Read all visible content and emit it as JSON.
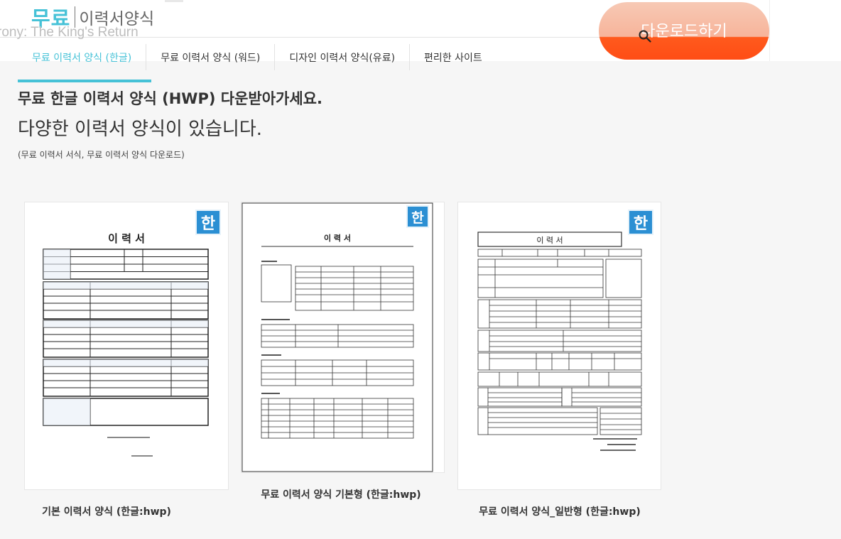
{
  "header": {
    "logo_main": "무료",
    "logo_sub": "이력서양식",
    "ghost_text": "rony: The King's Return",
    "download_label": "다운로드하기"
  },
  "nav": {
    "items": [
      {
        "label": "무료 이력서 양식 (한글)",
        "active": true
      },
      {
        "label": "무료 이력서 양식 (워드)",
        "active": false
      },
      {
        "label": "디자인 이력서 양식(유료)",
        "active": false
      },
      {
        "label": "편리한 사이트",
        "active": false
      }
    ]
  },
  "main": {
    "heading": "무료 한글 이력서 양식 (HWP) 다운받아가세요.",
    "subheading": "다양한 이력서 양식이 있습니다.",
    "note": "(무료 이력서 서식, 무료 이력서 양식 다운로드)"
  },
  "cards": [
    {
      "caption": "기본 이력서 양식 (한글:hwp)",
      "doc_title": "이 력 서",
      "icon": "hwp-icon"
    },
    {
      "caption": "무료 이력서 양식 기본형 (한글:hwp)",
      "doc_title": "이 력 서",
      "icon": "hwp-icon"
    },
    {
      "caption": "무료 이력서 양식_일반형 (한글:hwp)",
      "doc_title": "이 력 서",
      "icon": "hwp-icon"
    }
  ],
  "icon_glyph": "한",
  "colors": {
    "accent": "#46c2d7",
    "button": "#ff4d15",
    "hwp": "#2b8fd3"
  }
}
